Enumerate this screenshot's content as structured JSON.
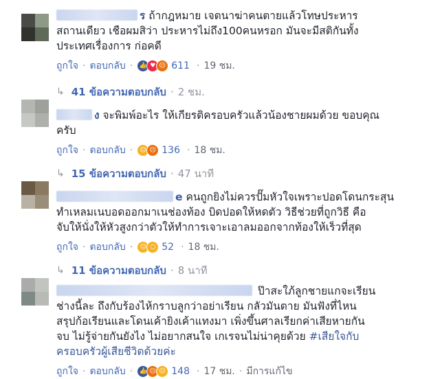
{
  "comments": [
    {
      "text_lines": [
        "ถ้ากฎหมาย เจตนาฆ่าคนตายแล้วโทษประหาร",
        "สถานเดียว เชือผมสิว่า ประหารไม่ถึง100คนหรอก มันจะมีสติกันทั้ง",
        "ประเทศเรื่องการ ก่อคดี"
      ],
      "name_suffix": "ร",
      "like": "ถูกใจ",
      "reply": "ตอบกลับ",
      "reaction_icons": [
        "like-icon",
        "love-icon",
        "angry-icon"
      ],
      "reaction_count": "611",
      "time": "19 ชม.",
      "replies_label": "41 ข้อความตอบกลับ",
      "replies_time": "2 ชม.",
      "avatar_colors": [
        "#4a4a48",
        "#8e9a86",
        "#2f322d",
        "#5f6b58"
      ]
    },
    {
      "text_lines": [
        "จะพิมพ์อะไร ให้เกียรติครอบครัวแล้วน้องชายผมด้วย ขอบคุณ",
        "ครับ"
      ],
      "name_suffix": "ง",
      "like": "ถูกใจ",
      "reply": "ตอบกลับ",
      "reaction_icons": [
        "haha-icon",
        "angry-icon"
      ],
      "reaction_count": "136",
      "time": "18 ชม.",
      "replies_label": "15 ข้อความตอบกลับ",
      "replies_time": "47 นาที",
      "avatar_colors": [
        "#b4b6b2",
        "#9ea09c",
        "#c6c8c4",
        "#aeb0ac"
      ]
    },
    {
      "text_lines": [
        "คนถูกยิงไม่ควรปั๊มหัวใจเพราะปอดโดนกระสุน",
        "ทำเหลมเนบอดออกมาเนช่องท้อง บิดปอดให้หดตัว วิธีช่วยที่ถูกวิธี คือ",
        "จับให้นั่งให้หัวสูงกว่าตัวให้ทำการเจาะเอาลมออกจากท้องให้เร็วที่สุด"
      ],
      "name_suffix": "e",
      "like": "ถูกใจ",
      "reply": "ตอบกลับ",
      "reaction_icons": [
        "haha-icon",
        "wow-icon"
      ],
      "reaction_count": "52",
      "time": "18 ชม.",
      "replies_label": "11 ข้อความตอบกลับ",
      "replies_time": "8 นาที",
      "avatar_colors": [
        "#6a5a44",
        "#8a7a62",
        "#b9b2a4",
        "#9a8e78"
      ]
    },
    {
      "text_lines": [
        "ป๊าสะใภ้ลูกชายแกจะเรียน",
        "ช่างนี้ละ ถึงกับร้องไห้กราบลูกว่าอย่าเรียน กลัวมันตาย มันฟังที่ไหน",
        "สรุปก้อเรียนและโดนเค้ายิงเค้าแทงมา เพิ่งขึ้นศาลเรียกค่าเสียหายกัน",
        "จบ ไม่รู้จ่ายกันยังไง ไม่อยากสนใจ เกเรจนไม่น่าคุยด้วย"
      ],
      "hashtag": "#เสียใจกับ",
      "hashtag_line2": "ครอบครัวผู้เสียชีวิตด้วยค่ะ",
      "like": "ถูกใจ",
      "reply": "ตอบกลับ",
      "reaction_icons": [
        "like-icon",
        "angry-icon",
        "haha-icon"
      ],
      "reaction_count": "148",
      "time": "17 ชม.",
      "edited": "มีการแก้ไข",
      "avatar_colors": [
        "#a9aca8",
        "#c2c4c0",
        "#7d8a86",
        "#b8bab6"
      ]
    }
  ]
}
